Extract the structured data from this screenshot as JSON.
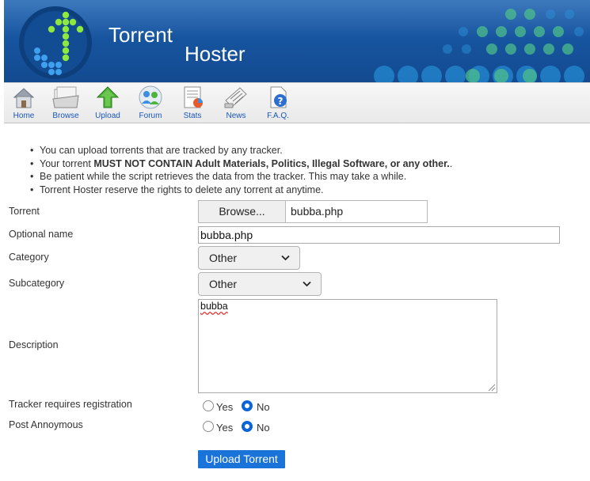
{
  "banner": {
    "title_line1": "Torrent",
    "title_line2": "Hoster",
    "logo_icon": "green-dot-arrow-logo-icon"
  },
  "nav": [
    {
      "label": "Home",
      "icon": "house-icon"
    },
    {
      "label": "Browse",
      "icon": "folder-tray-icon"
    },
    {
      "label": "Upload",
      "icon": "green-up-arrow-icon"
    },
    {
      "label": "Forum",
      "icon": "forum-people-icon"
    },
    {
      "label": "Stats",
      "icon": "stats-chart-icon"
    },
    {
      "label": "News",
      "icon": "news-paper-icon"
    },
    {
      "label": "F.A.Q.",
      "icon": "help-question-icon"
    }
  ],
  "notes": {
    "line1": "You can upload torrents that are tracked by any tracker.",
    "line2_prefix": "Your torrent ",
    "line2_bold": "MUST NOT CONTAIN Adult Materials, Politics, Illegal Software, or any other.",
    "line2_suffix": ".",
    "line3": "Be patient while the script retrieves the data from the tracker. This may take a while.",
    "line4": "Torrent Hoster reserve the rights to delete any torrent at anytime."
  },
  "form": {
    "torrent_label": "Torrent",
    "browse_label": "Browse...",
    "file_name": "bubba.php",
    "optional_name_label": "Optional name",
    "optional_name_value": "bubba.php",
    "category_label": "Category",
    "category_value": "Other",
    "subcategory_label": "Subcategory",
    "subcategory_value": "Other",
    "description_label": "Description",
    "description_value": "bubba",
    "tracker_reg_label": "Tracker requires registration",
    "post_anon_label": "Post Annoymous",
    "yes_label": "Yes",
    "no_label": "No",
    "tracker_reg_selected": "No",
    "post_anon_selected": "No",
    "submit_label": "Upload Torrent"
  },
  "colors": {
    "banner_blue": "#1a5cab",
    "nav_link": "#1a56b8",
    "radio_checked": "#0b65d8",
    "submit_bg": "#1a73d9"
  }
}
